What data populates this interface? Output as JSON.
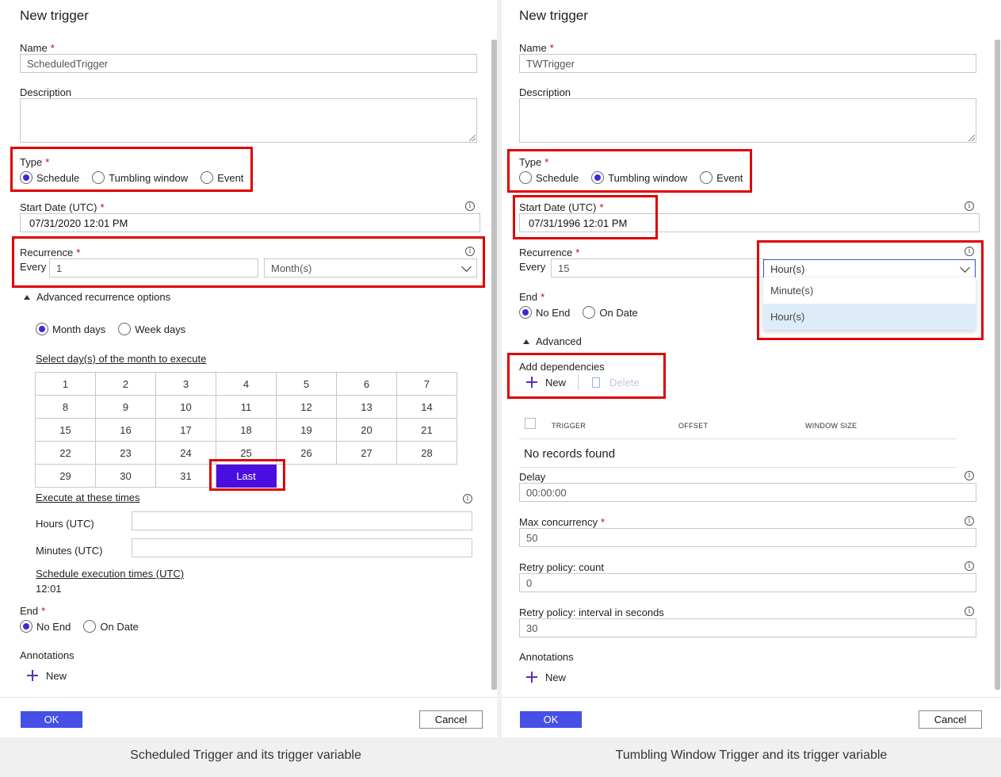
{
  "left": {
    "title": "New trigger",
    "name_label": "Name",
    "name_value": "ScheduledTrigger",
    "description_label": "Description",
    "type_label": "Type",
    "type_options": [
      "Schedule",
      "Tumbling window",
      "Event"
    ],
    "type_selected": "Schedule",
    "start_date_label": "Start Date (UTC)",
    "start_date_value": "07/31/2020 12:01 PM",
    "recurrence_label": "Recurrence",
    "every_label": "Every",
    "every_value": "1",
    "unit_value": "Month(s)",
    "advanced_label": "Advanced recurrence options",
    "day_mode_options": [
      "Month days",
      "Week days"
    ],
    "day_mode_selected": "Month days",
    "select_days_label": "Select day(s) of the month to execute",
    "days": [
      [
        "1",
        "2",
        "3",
        "4",
        "5",
        "6",
        "7"
      ],
      [
        "8",
        "9",
        "10",
        "11",
        "12",
        "13",
        "14"
      ],
      [
        "15",
        "16",
        "17",
        "18",
        "19",
        "20",
        "21"
      ],
      [
        "22",
        "23",
        "24",
        "25",
        "26",
        "27",
        "28"
      ],
      [
        "29",
        "30",
        "31",
        "Last"
      ]
    ],
    "selected_day": "Last",
    "execute_times_label": "Execute at these times",
    "hours_label": "Hours (UTC)",
    "minutes_label": "Minutes (UTC)",
    "schedule_times_label": "Schedule execution times (UTC)",
    "schedule_times_value": "12:01",
    "end_label": "End",
    "end_options": [
      "No End",
      "On Date"
    ],
    "end_selected": "No End",
    "annotations_label": "Annotations",
    "new_label": "New",
    "ok_label": "OK",
    "cancel_label": "Cancel",
    "caption": "Scheduled Trigger and its trigger variable"
  },
  "right": {
    "title": "New trigger",
    "name_label": "Name",
    "name_value": "TWTrigger",
    "description_label": "Description",
    "type_label": "Type",
    "type_options": [
      "Schedule",
      "Tumbling window",
      "Event"
    ],
    "type_selected": "Tumbling window",
    "start_date_label": "Start Date (UTC)",
    "start_date_value": "07/31/1996 12:01 PM",
    "recurrence_label": "Recurrence",
    "every_label": "Every",
    "every_value": "15",
    "unit_value": "Hour(s)",
    "unit_options": [
      "Minute(s)",
      "Hour(s)"
    ],
    "end_label": "End",
    "end_options": [
      "No End",
      "On Date"
    ],
    "end_selected": "No End",
    "advanced_label": "Advanced",
    "dependencies_label": "Add dependencies",
    "new_label": "New",
    "delete_label": "Delete",
    "table_headers": [
      "TRIGGER",
      "OFFSET",
      "WINDOW SIZE"
    ],
    "no_records": "No records found",
    "delay_label": "Delay",
    "delay_value": "00:00:00",
    "max_concurrency_label": "Max concurrency",
    "max_concurrency_value": "50",
    "retry_count_label": "Retry policy: count",
    "retry_count_value": "0",
    "retry_interval_label": "Retry policy: interval in seconds",
    "retry_interval_value": "30",
    "annotations_label": "Annotations",
    "ok_label": "OK",
    "cancel_label": "Cancel",
    "caption": "Tumbling Window Trigger and its trigger variable"
  },
  "colors": {
    "highlight": "#e00000",
    "primary": "#4650e6",
    "selected_day": "#4b0ee0",
    "dropdown_selected": "#deecfa"
  }
}
